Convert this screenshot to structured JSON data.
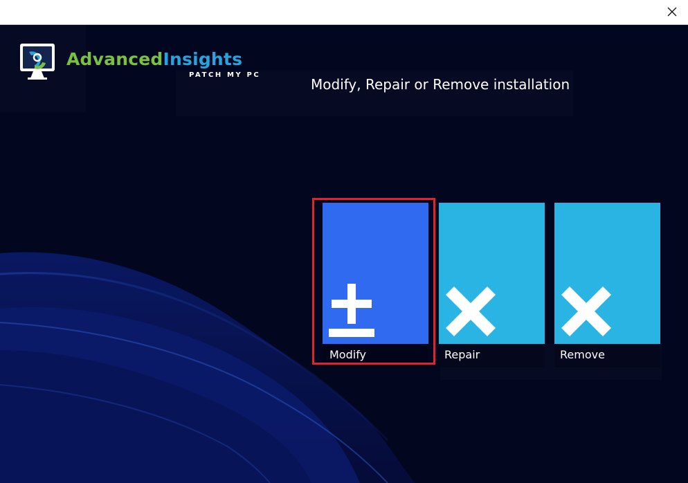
{
  "window": {
    "close_icon": "close-icon"
  },
  "brand": {
    "name_part1": "Advanced",
    "name_part2": "Insights",
    "tagline": "PATCH MY PC",
    "logo_icon": "monitor-logo-icon",
    "colors": {
      "green": "#7ac142",
      "blue": "#29a3dc"
    }
  },
  "page": {
    "title": "Modify, Repair or Remove installation",
    "background": "#03061f"
  },
  "tiles": [
    {
      "label": "Modify",
      "icon": "plus-minus-icon",
      "color": "#2f6af0",
      "selected": true
    },
    {
      "label": "Repair",
      "icon": "x-icon",
      "color": "#29b4e4",
      "selected": false
    },
    {
      "label": "Remove",
      "icon": "x-icon",
      "color": "#29b4e4",
      "selected": false
    }
  ],
  "highlight_color": "#e0242b"
}
